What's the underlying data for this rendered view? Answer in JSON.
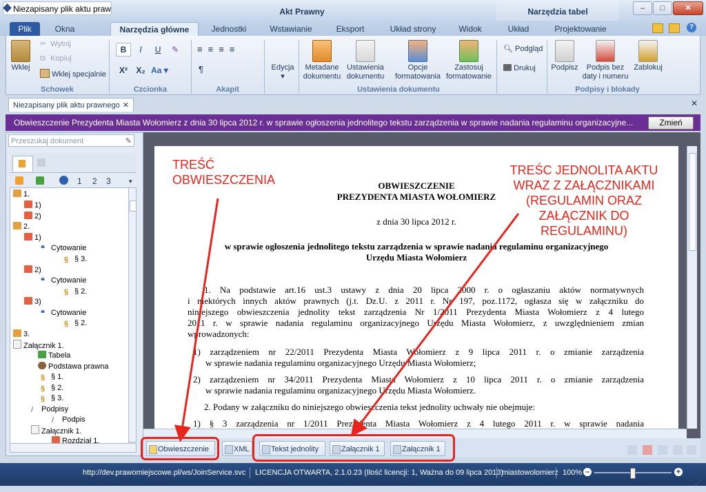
{
  "window": {
    "title": "Niezapisany plik aktu praw...",
    "context_title": "Akt Prawny",
    "context_tools": "Narzędzia tabel",
    "minimize": "–",
    "maximize": "□",
    "close": "✕"
  },
  "tabs": [
    "Plik",
    "Okna",
    "Narzędzia główne",
    "Jednostki",
    "Wstawianie",
    "Eksport",
    "Układ strony",
    "Widok",
    "Układ",
    "Projektowanie"
  ],
  "ribbon": {
    "paste": "Wklej",
    "cut": "Wytnij",
    "copy": "Kopiuj",
    "paste_special": "Wklej specjalnie",
    "group_clipboard": "Schowek",
    "bold": "B",
    "italic": "I",
    "underline": "U",
    "superscript": "X²",
    "subscript": "X₂",
    "font_color": "Aa",
    "group_font": "Czcionka",
    "pilcrow": "¶",
    "group_paragraph": "Akapit",
    "edit": "Edycja",
    "metadata_l1": "Metadane",
    "metadata_l2": "dokumentu",
    "settings_l1": "Ustawienia",
    "settings_l2": "dokumentu",
    "format_opts_l1": "Opcje",
    "format_opts_l2": "formatowania",
    "apply_fmt_l1": "Zastosuj",
    "apply_fmt_l2": "formatowanie",
    "group_doc_settings": "Ustawienia dokumentu",
    "preview": "Podgląd",
    "print": "Drukuj",
    "sign": "Podpisz",
    "sign_nodate_l1": "Podpis bez",
    "sign_nodate_l2": "daty i numeru",
    "lock": "Zablokuj",
    "group_signatures": "Podpisy i blokady"
  },
  "doc_tab": {
    "label": "Niezapisany plik aktu prawnego",
    "close": "✕"
  },
  "infobar": {
    "text": "Obwieszczenie Prezydenta Miasta Wołomierz z dnia 30 lipca 2012 r. w sprawie ogłoszenia jednolitego tekstu zarządzenia w sprawie nadania regulaminu organizacyjne...",
    "button": "Zmień"
  },
  "sidebar": {
    "search_placeholder": "Przeszukaj dokument",
    "levels": [
      "1",
      "2",
      "3"
    ],
    "tree": [
      {
        "label": "1.",
        "icon": "paragraph"
      },
      {
        "label": "1)",
        "icon": "list"
      },
      {
        "label": "2)",
        "icon": "list"
      },
      {
        "label": "2.",
        "icon": "paragraph"
      },
      {
        "label": "1)",
        "icon": "list"
      },
      {
        "label": "Cytowanie",
        "icon": "quote"
      },
      {
        "label": "§ 3.",
        "icon": "section"
      },
      {
        "label": "2)",
        "icon": "list"
      },
      {
        "label": "Cytowanie",
        "icon": "quote"
      },
      {
        "label": "§ 2.",
        "icon": "section"
      },
      {
        "label": "3)",
        "icon": "list"
      },
      {
        "label": "Cytowanie",
        "icon": "quote"
      },
      {
        "label": "§ 2.",
        "icon": "section"
      },
      {
        "label": "3.",
        "icon": "paragraph"
      },
      {
        "label": "Załącznik 1.",
        "icon": "attachment"
      },
      {
        "label": "Tabela",
        "icon": "table"
      },
      {
        "label": "Podstawa prawna",
        "icon": "legal"
      },
      {
        "label": "§ 1.",
        "icon": "section"
      },
      {
        "label": "§ 2.",
        "icon": "section"
      },
      {
        "label": "§ 3.",
        "icon": "section"
      },
      {
        "label": "Podpisy",
        "icon": "signature"
      },
      {
        "label": "Podpis",
        "icon": "signature"
      },
      {
        "label": "Załącznik 1.",
        "icon": "attachment"
      },
      {
        "label": "Rozdział 1.",
        "icon": "chapter"
      }
    ]
  },
  "document": {
    "heading1": "OBWIESZCZENIE",
    "heading2": "PREZYDENTA MIASTA WOŁOMIERZ",
    "date": "z dnia 30 lipca 2012 r.",
    "subject_l1": "w sprawie ogłoszenia jednolitego tekstu zarządzenia w sprawie nadania regulaminu organizacyjnego",
    "subject_l2": "Urzędu Miasta Wołomierz",
    "p1_l1": "1. Na podstawie art.16 ust.3 ustawy z dnia 20 lipca 2000 r. o ogłaszaniu aktów normatywnych",
    "p1_l2": "i niektórych innych aktów prawnych (j.t. Dz.U. z 2011 r. Nr 197, poz.1172, ogłasza się w załączniku do",
    "p1_l3": "niniejszego obwieszczenia jednolity tekst zarządzenia Nr 1/2011 Prezydenta Miasta Wołomierz z 4 lutego",
    "p1_l4": "2011 r. w sprawie nadania regulaminu organizacyjnego Urzędu Miasta Wołomierz, z uwzględnieniem zmian",
    "p1_l5": "wprowadzonych:",
    "i1_l1": "1) zarządzeniem nr 22/2011 Prezydenta Miasta Wołomierz z 9 lipca 2011 r. o zmianie zarządzenia",
    "i1_l2": "w sprawie nadania regulaminu organizacyjnego Urzędu Miasta Wołomierz;",
    "i2_l1": "2) zarządzeniem nr 34/2011 Prezydenta Miasta Wołomierz z 10 lipca 2011 r. o zmianie zarządzenia",
    "i2_l2": "w sprawie nadania regulaminu organizacyjnego Urzędu Miasta Wołomierz.",
    "p2": "2. Podany w załączniku do niniejszego obwieszczenia tekst jednolity uchwały nie obejmuje:",
    "i3_l1": "1) § 3 zarządzenia nr 1/2011 Prezydenta Miasta Wołomierz z 4 lutego 2011 r. w sprawie nadania"
  },
  "annotations": {
    "left_l1": "TREŚĆ",
    "left_l2": "OBWIESZCZENIA",
    "right_l1": "TREŚC JEDNOLITA AKTU",
    "right_l2": "WRAZ Z ZAŁĄCZNIKAMI",
    "right_l3": "(REGULAMIN ORAZ",
    "right_l4": "ZAŁĄCZNIK DO",
    "right_l5": "REGULAMINU)",
    "color": "#e8251c"
  },
  "bottom_tabs": [
    "Obwieszczenie",
    "XML",
    "Tekst jednolity",
    "Załącznik 1",
    "Załącznik 1"
  ],
  "status": {
    "url": "http://dev.prawomiejscowe.pl/ws/JoinService.svc",
    "license": "LICENCJA OTWARTA, 2.1.0.23 (Ilość licencji: 1, Ważna do 09 lipca 2013)",
    "user": "miastowolomierz",
    "zoom": "100%",
    "zoom_fraction": 0.5
  },
  "colors": {
    "accent": "#2d5aa3",
    "infobar": "#6a2f94",
    "annotation": "#e8251c"
  }
}
